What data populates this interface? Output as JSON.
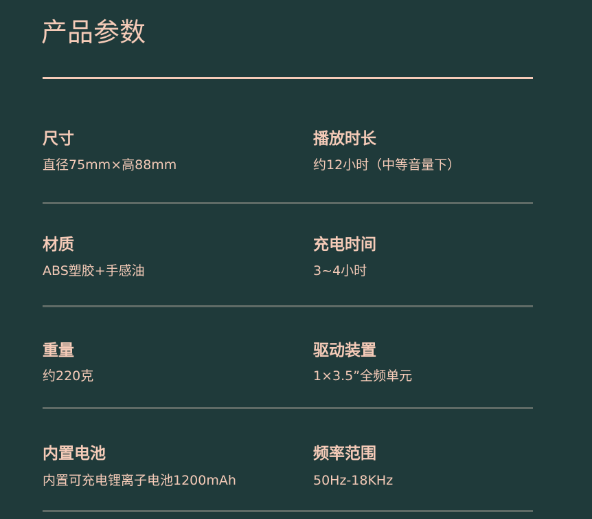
{
  "title": "产品参数",
  "colors": {
    "background": "#1f3a3a",
    "text": "#f5cbb8",
    "divider": "#5f6b66"
  },
  "rows": [
    {
      "left": {
        "label": "尺寸",
        "value": "直径75mm×高88mm"
      },
      "right": {
        "label": "播放时长",
        "value": "约12小时（中等音量下）"
      }
    },
    {
      "left": {
        "label": "材质",
        "value": "ABS塑胶+手感油"
      },
      "right": {
        "label": "充电时间",
        "value": "3~4小时"
      }
    },
    {
      "left": {
        "label": "重量",
        "value": "约220克"
      },
      "right": {
        "label": "驱动装置",
        "value": "1×3.5”全频单元"
      }
    },
    {
      "left": {
        "label": "内置电池",
        "value": "内置可充电锂离子电池1200mAh"
      },
      "right": {
        "label": "频率范围",
        "value": "50Hz-18KHz"
      }
    }
  ]
}
